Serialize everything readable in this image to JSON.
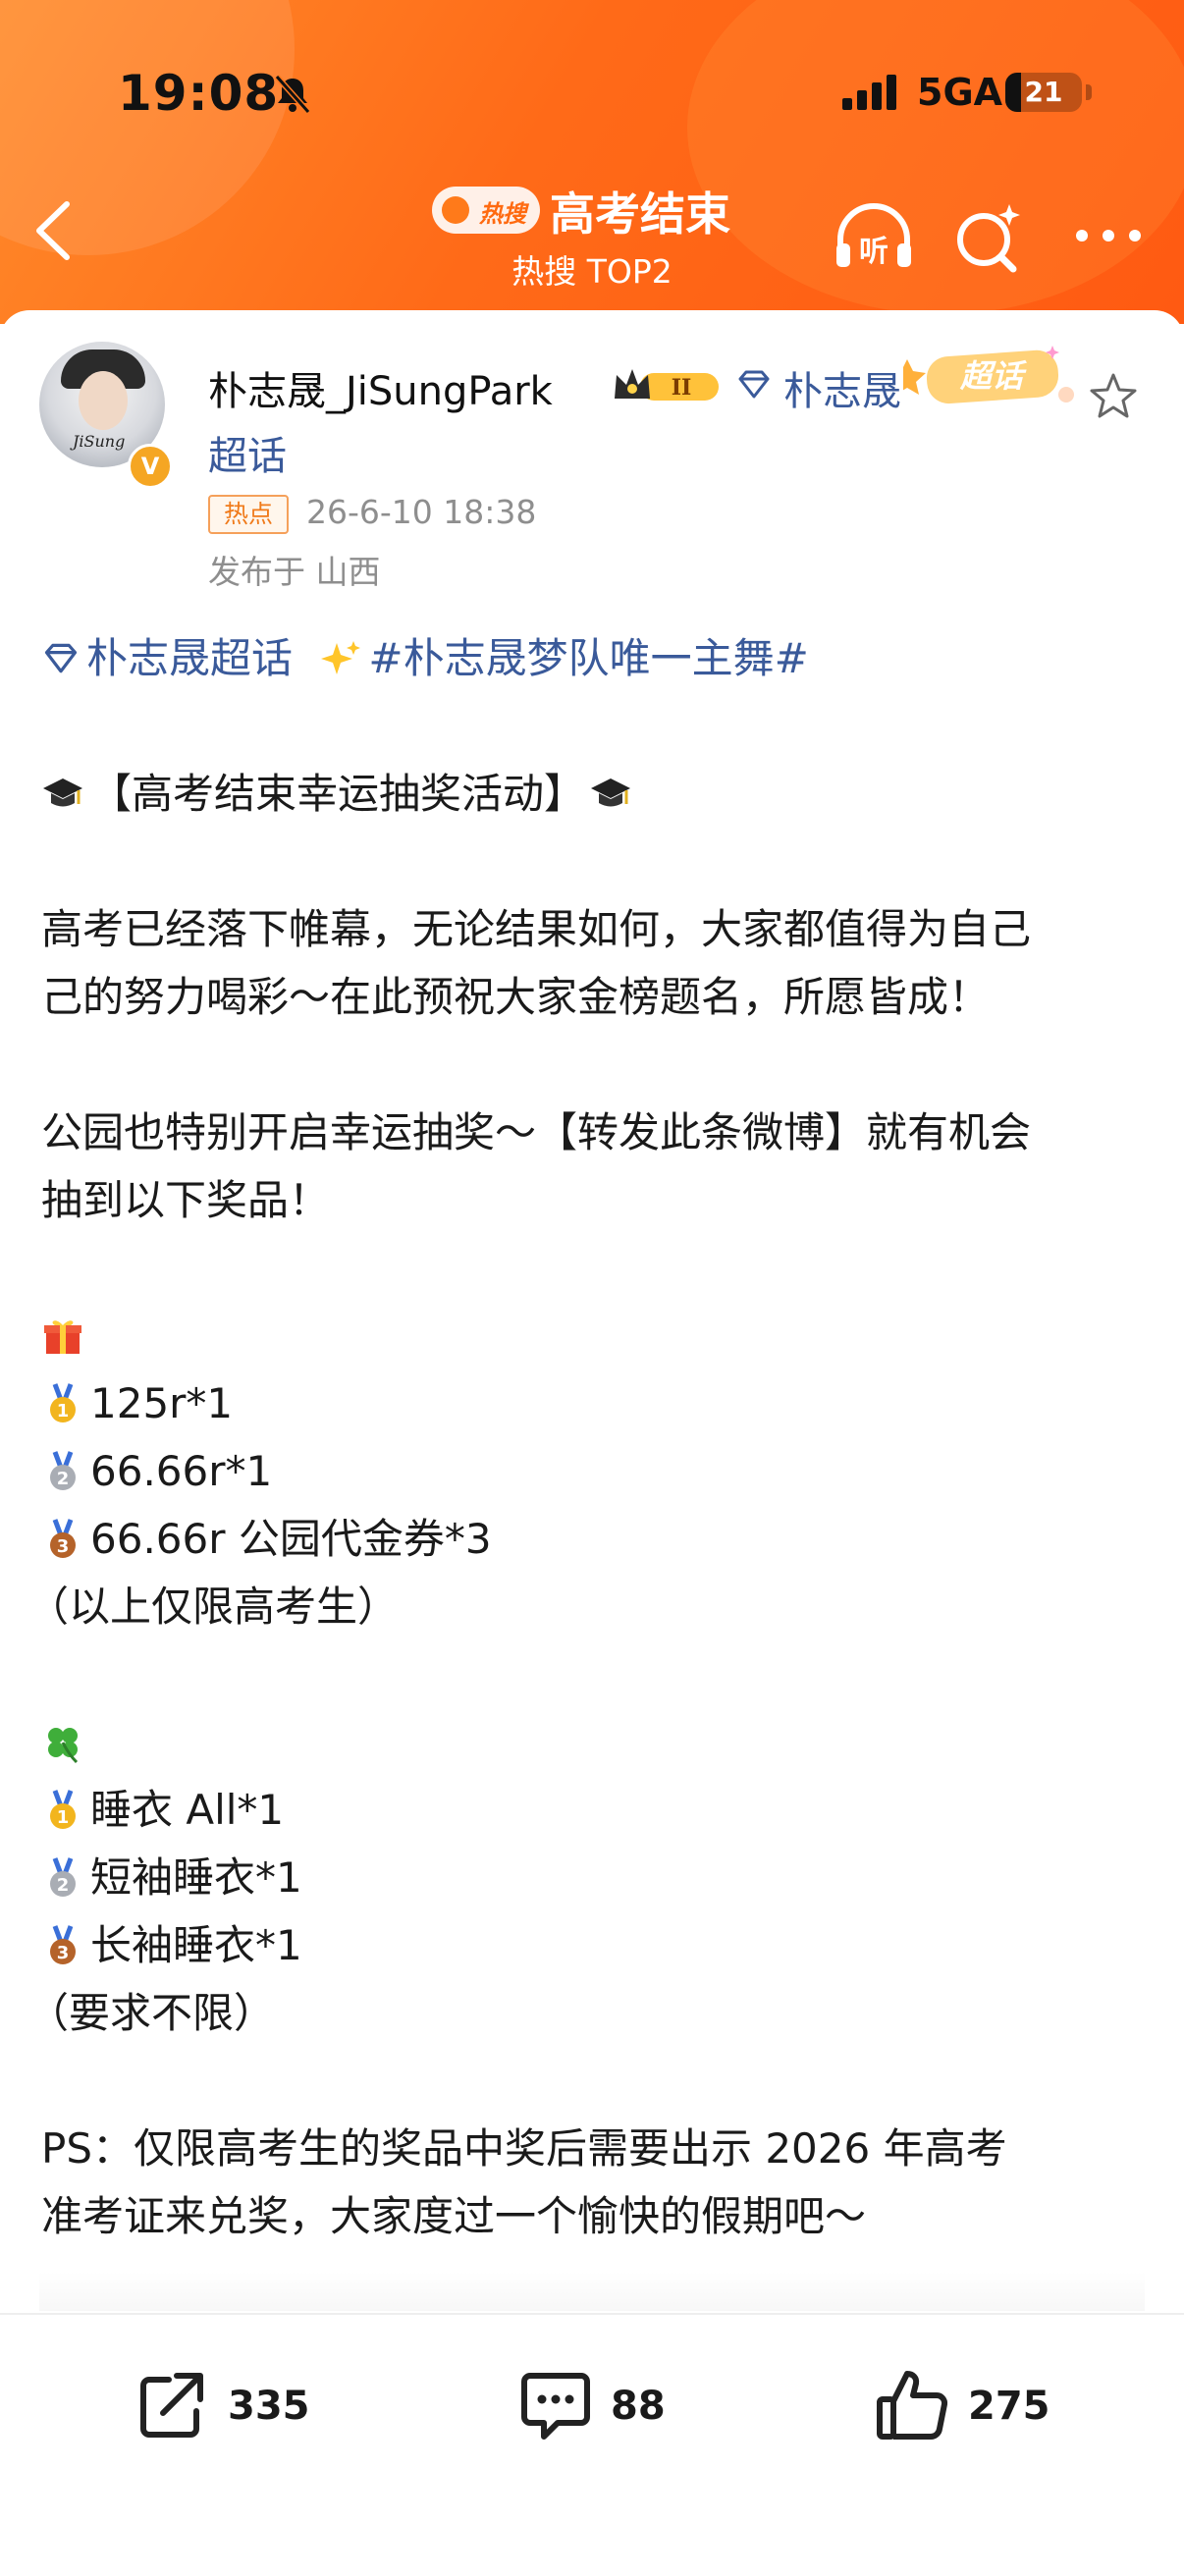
{
  "status_bar": {
    "time": "19:08",
    "network": "5GA",
    "battery": "21",
    "battery_level": 0.21
  },
  "header": {
    "hot_badge": "热搜",
    "title": "高考结束",
    "subtitle": "热搜 TOP2",
    "listen_label": "听"
  },
  "post": {
    "username": "朴志晟_JiSungPark",
    "supertopic_line1": "朴志晟",
    "supertopic_line2": "超话",
    "chaohua_tag": "超话",
    "hot_tag": "热点",
    "timestamp": "26-6-10 18:38",
    "location": "发布于 山西",
    "avatar_signature": "JiSung",
    "lines": {
      "l1_link": "朴志晟超话",
      "l1_topic": "#朴志晟梦队唯一主舞#",
      "title": "【高考结束幸运抽奖活动】",
      "p1a": "高考已经落下帷幕，无论结果如何，大家都值得为自己",
      "p1b": "己的努力喝彩～在此预祝大家金榜题名，所愿皆成！",
      "p2a": "公园也特别开启幸运抽奖～【转发此条微博】就有机会",
      "p2b": "抽到以下奖品！",
      "g1": "125r*1",
      "g2": "66.66r*1",
      "g3": "66.66r 公园代金券*3",
      "g_note": "（以上仅限高考生）",
      "c1": "睡衣 All*1",
      "c2": "短袖睡衣*1",
      "c3": "长袖睡衣*1",
      "c_note": "（要求不限）",
      "ps_a": "PS：仅限高考生的奖品中奖后需要出示 2026 年高考",
      "ps_b": "准考证来兑奖，大家度过一个愉快的假期吧～"
    }
  },
  "actions": {
    "repost_count": "335",
    "comment_count": "88",
    "like_count": "275"
  },
  "colors": {
    "header_orange": "#ff6a18",
    "link_blue": "#3a5a9a",
    "gray": "#8e8e8e",
    "hot_orange": "#f07a1a"
  }
}
